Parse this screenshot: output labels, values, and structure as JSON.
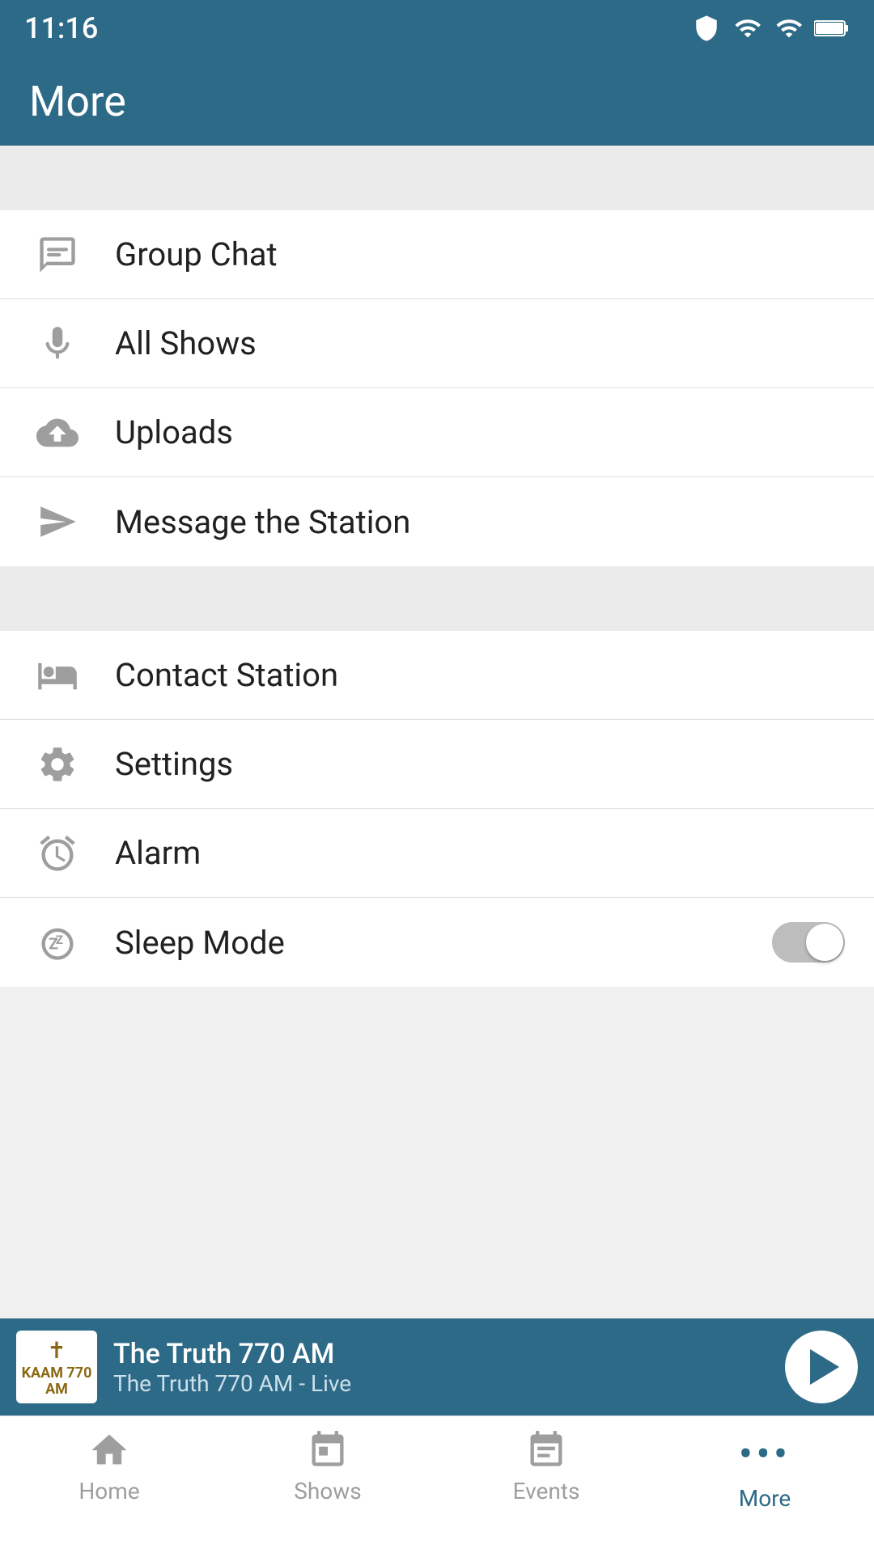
{
  "statusBar": {
    "time": "11:16",
    "icons": [
      "shield",
      "wifi",
      "signal",
      "battery"
    ]
  },
  "appBar": {
    "title": "More"
  },
  "menuSections": [
    {
      "items": [
        {
          "id": "group-chat",
          "label": "Group Chat",
          "icon": "chat"
        },
        {
          "id": "all-shows",
          "label": "All Shows",
          "icon": "mic"
        },
        {
          "id": "uploads",
          "label": "Uploads",
          "icon": "upload"
        },
        {
          "id": "message-station",
          "label": "Message the Station",
          "icon": "send"
        }
      ]
    },
    {
      "items": [
        {
          "id": "contact-station",
          "label": "Contact Station",
          "icon": "building"
        },
        {
          "id": "settings",
          "label": "Settings",
          "icon": "gear"
        },
        {
          "id": "alarm",
          "label": "Alarm",
          "icon": "alarm"
        },
        {
          "id": "sleep-mode",
          "label": "Sleep Mode",
          "icon": "sleep",
          "hasToggle": true
        }
      ]
    }
  ],
  "nowPlaying": {
    "stationName": "The Truth 770 AM",
    "stationSub": "The Truth 770 AM - Live",
    "logoText": "KAAM 770 AM",
    "isPlaying": false
  },
  "bottomNav": {
    "items": [
      {
        "id": "home",
        "label": "Home",
        "icon": "home",
        "active": false
      },
      {
        "id": "shows",
        "label": "Shows",
        "icon": "calendar",
        "active": false
      },
      {
        "id": "events",
        "label": "Events",
        "icon": "events",
        "active": false
      },
      {
        "id": "more",
        "label": "More",
        "icon": "dots",
        "active": true
      }
    ]
  }
}
